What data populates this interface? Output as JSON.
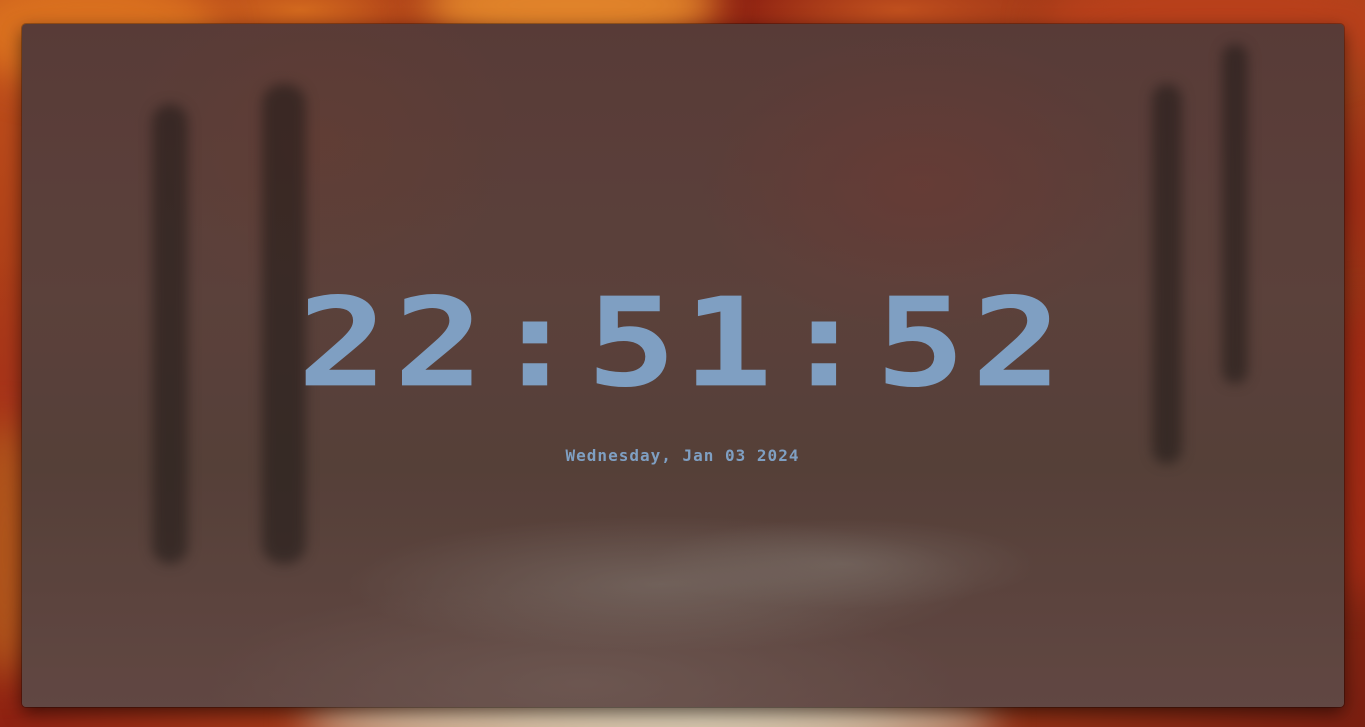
{
  "clock": {
    "time": "22:51:52",
    "date": "Wednesday, Jan 03 2024"
  },
  "colors": {
    "accent": "#7f9fc2",
    "panel": "#5e3f3a"
  }
}
